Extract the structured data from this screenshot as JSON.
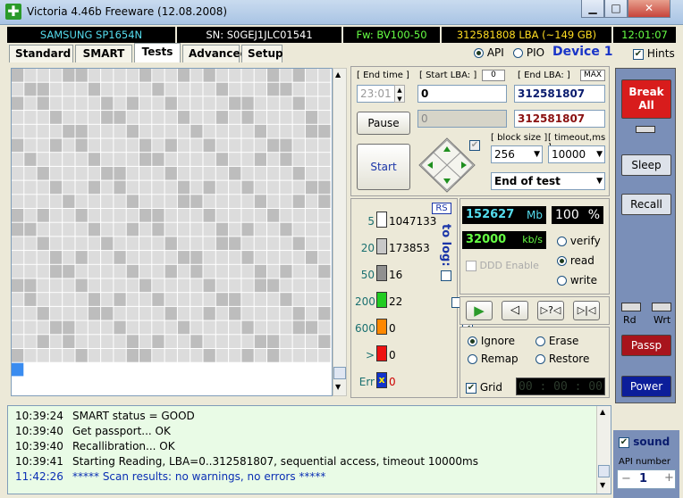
{
  "window": {
    "title": "Victoria 4.46b Freeware (12.08.2008)",
    "icon": "plus-icon",
    "buttons": [
      "minimize",
      "maximize",
      "close"
    ]
  },
  "info": {
    "model": "SAMSUNG SP1654N",
    "serial": "SN: S0GEJ1JLC01541",
    "firmware": "Fw: BV100-50",
    "lba": "312581808 LBA (~149 GB)",
    "clock": "12:01:07"
  },
  "tabs": [
    {
      "label": "Standard"
    },
    {
      "label": "SMART"
    },
    {
      "label": "Tests",
      "active": true
    },
    {
      "label": "Advanced"
    },
    {
      "label": "Setup"
    }
  ],
  "mode": {
    "api": "API",
    "pio": "PIO",
    "device": "Device 1",
    "hints": "Hints"
  },
  "test": {
    "end_time_label": "[ End time ]",
    "end_time_value": "23:01",
    "start_lba_label": "[ Start LBA: ]",
    "start_lba_value": "0",
    "start_lba_zero": "0",
    "end_lba_label": "[ End LBA: ]",
    "end_lba_max": "MAX",
    "end_lba_value": "312581807",
    "current_value": "0",
    "current_end": "312581807",
    "pause": "Pause",
    "start": "Start",
    "block_size_label": "[ block size ]",
    "block_size": "256",
    "timeout_label": "[ timeout,ms ]",
    "timeout": "10000",
    "end_action": "End of test"
  },
  "stats": {
    "rs": "RS",
    "to_log": "to log:",
    "rows": [
      {
        "ms": "5",
        "count": "1047133",
        "color": "#ffffff"
      },
      {
        "ms": "20",
        "count": "173853",
        "color": "#c8c8c8"
      },
      {
        "ms": "50",
        "count": "16",
        "color": "#909090"
      },
      {
        "ms": "200",
        "count": "22",
        "color": "#22cc22"
      },
      {
        "ms": "600",
        "count": "0",
        "color": "#ff8800"
      },
      {
        "ms": ">",
        "count": "0",
        "color": "#ee1111"
      },
      {
        "ms": "Err",
        "count": "0",
        "color": "#1133cc",
        "mark": "x"
      }
    ],
    "log_checks": [
      false,
      false,
      false,
      false,
      true,
      true,
      true
    ]
  },
  "speed": {
    "mb": "152627",
    "mb_unit": "Mb",
    "percent": "100",
    "percent_unit": "%",
    "kbs": "32000",
    "kbs_unit": "kb/s",
    "ddd": "DDD Enable"
  },
  "access": {
    "verify": "verify",
    "read": "read",
    "write": "write",
    "selected": "read"
  },
  "actions": {
    "ignore": "Ignore",
    "erase": "Erase",
    "remap": "Remap",
    "restore": "Restore",
    "grid": "Grid",
    "timer": "00 : 00 : 00"
  },
  "sidebar": {
    "break": "Break All",
    "sleep": "Sleep",
    "recall": "Recall",
    "rd": "Rd",
    "wrt": "Wrt",
    "passp": "Passp",
    "power": "Power",
    "sound": "sound",
    "api_label": "API number",
    "api_value": "1",
    "minus": "−",
    "plus": "+"
  },
  "log": [
    {
      "time": "10:39:24",
      "text": "SMART status = GOOD",
      "color": "#000000"
    },
    {
      "time": "10:39:40",
      "text": "Get passport... OK",
      "color": "#000000"
    },
    {
      "time": "10:39:40",
      "text": "Recallibration... OK",
      "color": "#000000"
    },
    {
      "time": "10:39:41",
      "text": "Starting Reading, LBA=0..312581807, sequential access, timeout 10000ms",
      "color": "#000000"
    },
    {
      "time": "11:42:26",
      "text": "***** Scan results: no warnings, no errors *****",
      "color": "#0a2fb4"
    }
  ]
}
